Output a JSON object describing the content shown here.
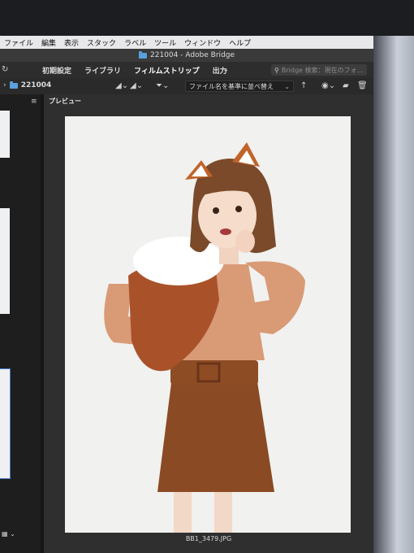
{
  "menu": [
    "ファイル",
    "編集",
    "表示",
    "スタック",
    "ラベル",
    "ツール",
    "ウィンドウ",
    "ヘルプ"
  ],
  "window_title": "221004 - Adobe Bridge",
  "workspace_tabs": [
    {
      "label": "初期設定",
      "active": false
    },
    {
      "label": "ライブラリ",
      "active": false
    },
    {
      "label": "フィルムストリップ",
      "active": true
    },
    {
      "label": "出力",
      "active": false
    }
  ],
  "search_placeholder": "Bridge 検索：現在のフォ...",
  "path_folder": "221004",
  "sort_label": "ファイル名を基準に並べ替え",
  "preview_tab": "プレビュー",
  "file_name": "BB1_3479.JPG",
  "colors": {
    "folder": "#5aa0de",
    "selection": "#4a7ad0"
  }
}
